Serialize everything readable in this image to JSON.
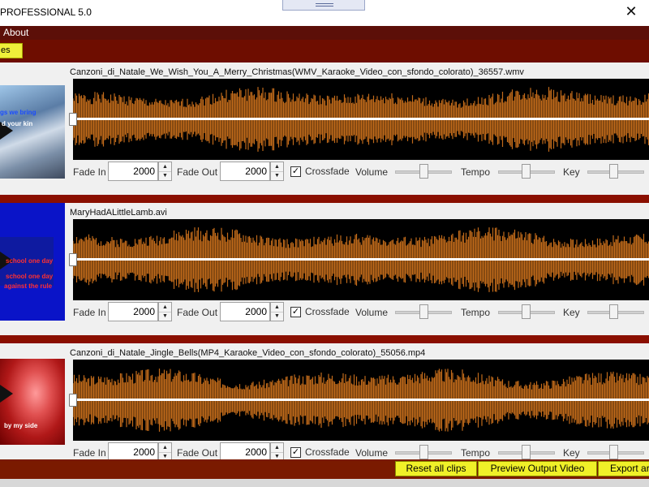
{
  "window": {
    "title": "PROFESSIONAL 5.0",
    "close_glyph": "✕"
  },
  "menu": {
    "about": "About"
  },
  "toolbar": {
    "button_label": "es"
  },
  "clips": [
    {
      "filename": "Canzoni_di_Natale_We_Wish_You_A_Merry_Christmas(WMV_Karaoke_Video_con_sfondo_colorato)_36557.wmv",
      "thumb_lines": [
        "gs we bring",
        "d your kin"
      ],
      "fade_in": "2000",
      "fade_out": "2000",
      "crossfade": true
    },
    {
      "filename": "MaryHadALittleLamb.avi",
      "thumb_lines": [
        "school one day",
        "school one day",
        "against the rule"
      ],
      "fade_in": "2000",
      "fade_out": "2000",
      "crossfade": true
    },
    {
      "filename": "Canzoni_di_Natale_Jingle_Bells(MP4_Karaoke_Video_con_sfondo_colorato)_55056.mp4",
      "thumb_lines": [
        "by my side"
      ],
      "fade_in": "2000",
      "fade_out": "2000",
      "crossfade": true
    }
  ],
  "labels": {
    "fade_in": "Fade In",
    "fade_out": "Fade Out",
    "crossfade": "Crossfade",
    "volume": "Volume",
    "tempo": "Tempo",
    "key": "Key",
    "check": "✓",
    "spin_up": "▲",
    "spin_down": "▼"
  },
  "actions": {
    "reset": "Reset all clips",
    "preview": "Preview Output Video",
    "export": "Export ar"
  },
  "colors": {
    "waveform": "#c06a1a",
    "accent_bar": "#8a0f00",
    "button": "#f0f028"
  }
}
